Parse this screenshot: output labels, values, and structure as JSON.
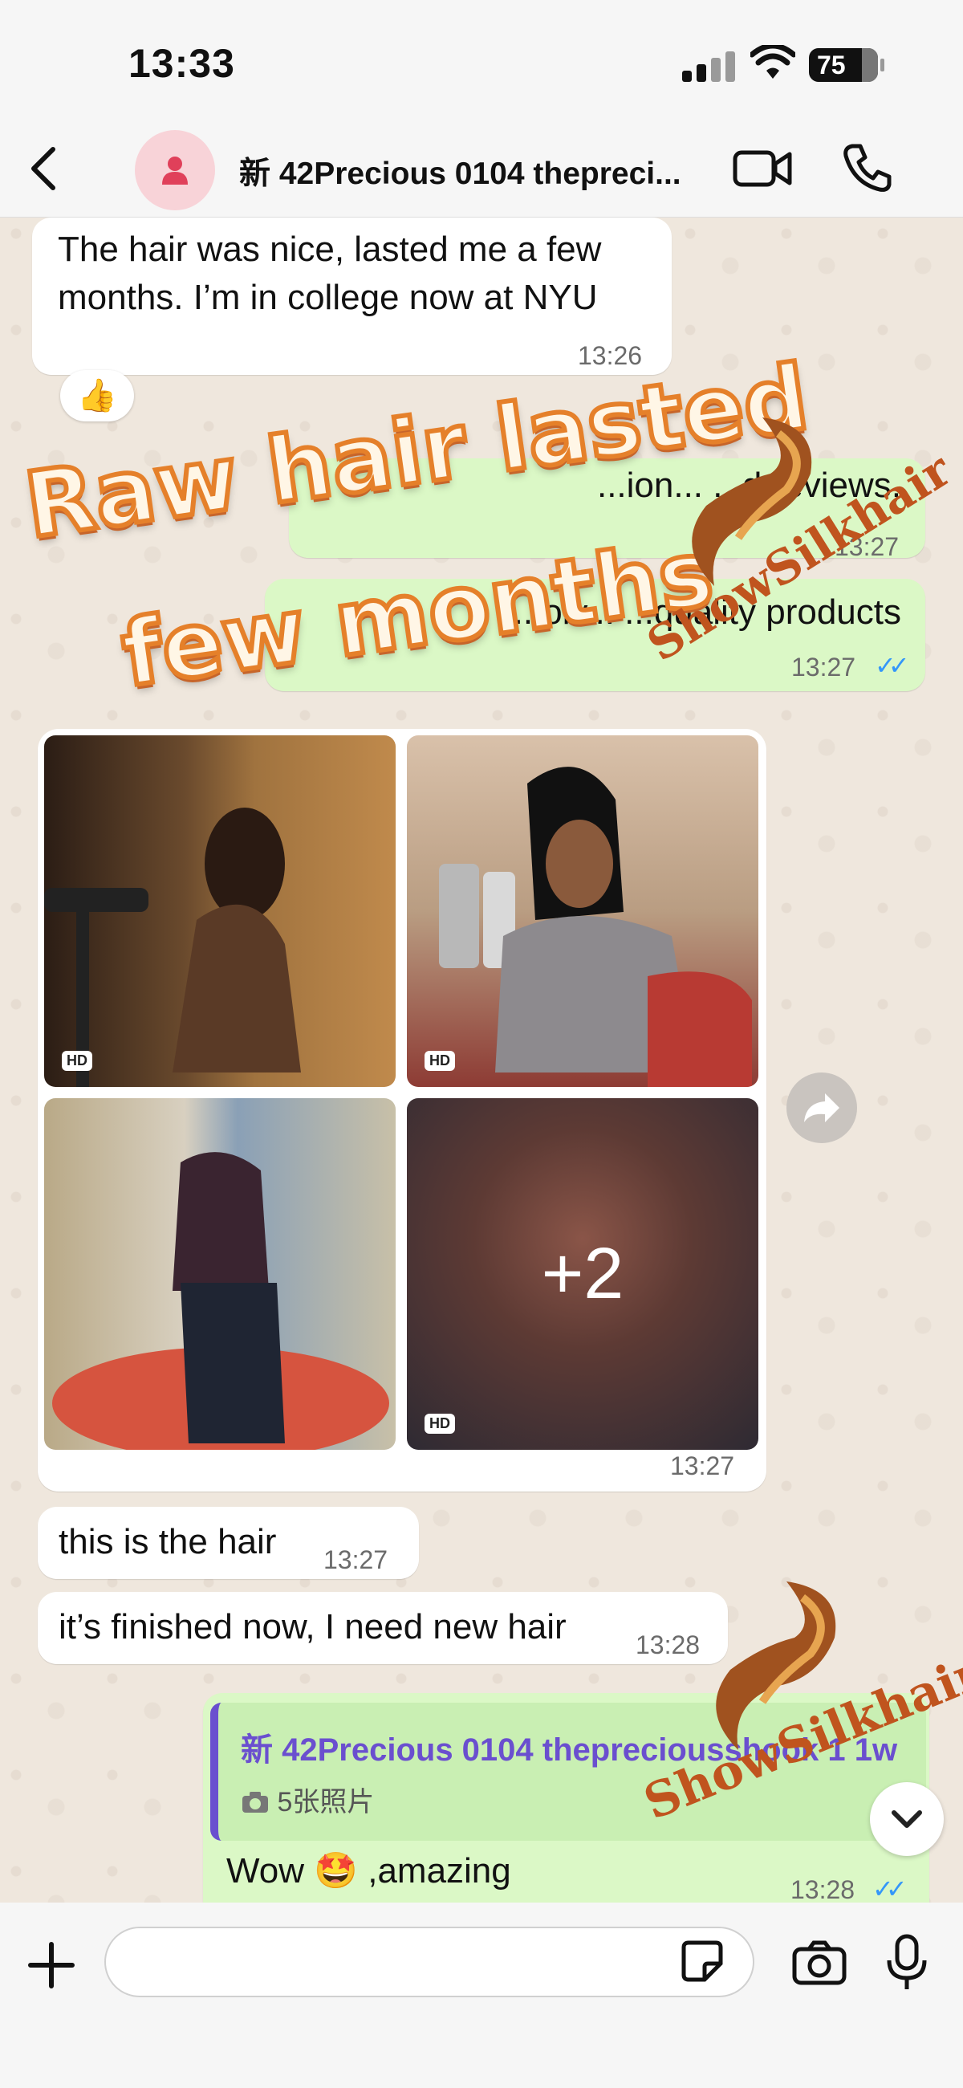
{
  "status": {
    "time": "13:33",
    "battery": "75"
  },
  "header": {
    "back_icon": "chevron-left-icon",
    "title": "新 42Precious 0104 thepreci..."
  },
  "messages": [
    {
      "text": "The hair was nice, lasted me a few months. I’m in college now at NYU",
      "time": "13:26",
      "reaction": "👍"
    },
    {
      "text": "...ion... ...d reviews,",
      "time": "13:27"
    },
    {
      "text": "...olv... ...quality products",
      "time": "13:27"
    }
  ],
  "album": {
    "more_count": "+2",
    "time": "13:27",
    "hd_label": "HD"
  },
  "incoming": [
    {
      "text": "this is the hair",
      "time": "13:27"
    },
    {
      "text": "it’s finished now, I need new hair",
      "time": "13:28"
    }
  ],
  "reply": {
    "quoted_name": "新 42Precious 0104 thepreciousshook 1 1w",
    "quoted_subtitle": "5张照片",
    "text": "Wow 🤩 ,amazing",
    "time": "13:28"
  },
  "overlay": {
    "line1": "Raw hair lasted",
    "line2": "few months"
  },
  "watermark": {
    "brand": "ShowSilkhair"
  },
  "colors": {
    "outgoing": "#dbf8c6",
    "incoming": "#ffffff",
    "accent_ticks": "#3497f9",
    "quote_bar": "#6a4fcf"
  }
}
